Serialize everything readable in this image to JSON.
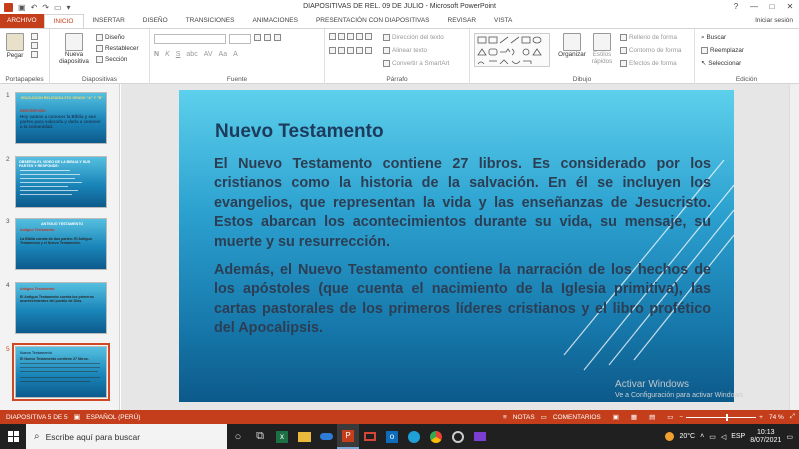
{
  "window": {
    "title": "DIAPOSITIVAS DE REL. 09 DE JULIO  -  Microsoft PowerPoint",
    "controls": [
      "?",
      "—",
      "□",
      "✕"
    ]
  },
  "tabs": [
    "ARCHIVO",
    "INICIO",
    "INSERTAR",
    "DISEÑO",
    "TRANSICIONES",
    "ANIMACIONES",
    "PRESENTACIÓN CON DIAPOSITIVAS",
    "REVISAR",
    "VISTA"
  ],
  "signin": "Iniciar sesión",
  "ribbon": {
    "portapapeles": {
      "label": "Portapapeles",
      "paste": "Pegar"
    },
    "diapositivas": {
      "label": "Diapositivas",
      "new_slide": "Nueva diapositiva",
      "layout": "Diseño",
      "reset": "Restablecer",
      "section": "Sección"
    },
    "fuente": {
      "label": "Fuente",
      "font_value": "",
      "size_value": "",
      "buttons": [
        "N",
        "K",
        "S",
        "abc",
        "AV",
        "Aa",
        "A"
      ]
    },
    "parrafo": {
      "label": "Párrafo",
      "text_direction": "Dirección del texto",
      "align_text": "Alinear texto",
      "smartart": "Convertir a SmartArt"
    },
    "dibujo": {
      "label": "Dibujo",
      "arrange": "Organizar",
      "quick_styles": "Estilos rápidos",
      "fill": "Relleno de forma",
      "outline": "Contorno de forma",
      "effects": "Efectos de forma"
    },
    "edicion": {
      "label": "Edición",
      "find": "Buscar",
      "replace": "Reemplazar",
      "select": "Seleccionar"
    }
  },
  "thumbnails": [
    {
      "num": "1",
      "title": "EDUCACIÓN RELIGIOSA\n6TO GRADO \"A\" Y \"B\"",
      "subtitle": "DESCRIPCIÓN:",
      "body": "Hoy vamos a conocer la Biblia y sus partes para valorarla y darla a conocer a la comunidad."
    },
    {
      "num": "2",
      "title": "OBSERVA EL VIDEO DE LA BIBLIA Y SUS PARTES Y RESPONDE:",
      "subtitle": "",
      "body": ""
    },
    {
      "num": "3",
      "title": "ANTIGUO TESTAMENTO",
      "subtitle": "Antiguo Testamento",
      "body": "La Biblia consta de dos partes: El Antiguo Testamento y el Nuevo Testamento."
    },
    {
      "num": "4",
      "title": "",
      "subtitle": "Antiguo Testamento",
      "body": "El Antiguo Testamento cuenta los primeros acontecimientos del pueblo de Dios."
    },
    {
      "num": "5",
      "title": "",
      "subtitle": "Nuevo Testamento",
      "body": "El Nuevo Testamento contiene 27 libros."
    }
  ],
  "slide": {
    "title": "Nuevo Testamento",
    "p1": "El Nuevo Testamento contiene 27 libros. Es considerado por los cristianos como la historia de la salvación. En él se incluyen los evangelios, que representan la vida y las enseñanzas de Jesucristo. Estos abarcan los acontecimientos durante su vida, su mensaje, su muerte y su resurrección.",
    "p2": "Además, el Nuevo Testamento contiene la narración de los hechos de los apóstoles (que cuenta el nacimiento de la Iglesia primitiva), las cartas pastorales de los primeros líderes cristianos y el libro profético del Apocalipsis."
  },
  "watermark": {
    "line1": "Activar Windows",
    "line2": "Ve a Configuración para activar Windows."
  },
  "statusbar": {
    "slide": "DIAPOSITIVA 5 DE 5",
    "language": "ESPAÑOL (PERÚ)",
    "notes": "NOTAS",
    "comments": "COMENTARIOS",
    "zoom": "74 %"
  },
  "taskbar": {
    "search_placeholder": "Escribe aquí para buscar",
    "weather": "20°C",
    "language": "ESP",
    "time": "10:13",
    "date": "8/07/2021"
  },
  "colors": {
    "accent": "#c43e1c",
    "selected_thumb": "#d24726",
    "slide_title": "#1d3b5c",
    "slide_text": "#2c3e54"
  }
}
